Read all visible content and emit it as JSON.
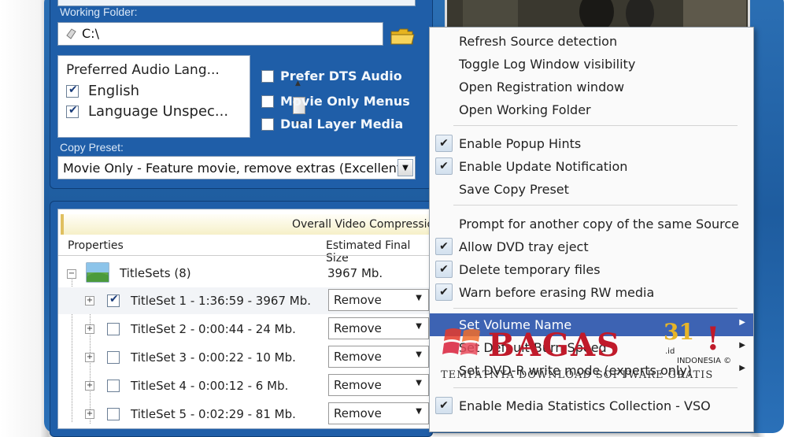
{
  "working_folder": {
    "label": "Working Folder:",
    "value": "C:\\"
  },
  "audio_languages": {
    "header": "Preferred Audio Lang...",
    "items": [
      {
        "label": "English",
        "checked": true
      },
      {
        "label": "Language Unspec...",
        "checked": true
      }
    ]
  },
  "options": {
    "prefer_dts": "Prefer DTS Audio",
    "movie_only_menus": "Movie Only Menus",
    "dual_layer": "Dual Layer Media"
  },
  "copy_preset": {
    "label": "Copy Preset:",
    "value": "Movie Only - Feature movie, remove extras (Excellent)"
  },
  "grid": {
    "banner": "Overall Video Compression",
    "col_properties": "Properties",
    "col_size": "Estimated Final Size",
    "root": {
      "label": "TitleSets (8)",
      "size": "3967 Mb."
    },
    "rows": [
      {
        "label": "TitleSet 1 -  1:36:59 - 3967 Mb.",
        "checked": true,
        "action": "Remove"
      },
      {
        "label": "TitleSet 2 -  0:00:44 - 24 Mb.",
        "checked": false,
        "action": "Remove"
      },
      {
        "label": "TitleSet 3 -  0:00:22 - 10 Mb.",
        "checked": false,
        "action": "Remove"
      },
      {
        "label": "TitleSet 4 -  0:00:12 - 6 Mb.",
        "checked": false,
        "action": "Remove"
      },
      {
        "label": "TitleSet 5 -  0:02:29 - 81 Mb.",
        "checked": false,
        "action": "Remove"
      }
    ]
  },
  "menu": {
    "items": [
      {
        "label": "Refresh Source detection",
        "checked": false
      },
      {
        "label": "Toggle Log Window visibility",
        "checked": false
      },
      {
        "label": "Open Registration window",
        "checked": false
      },
      {
        "label": "Open Working Folder",
        "checked": false
      },
      {
        "label": "Enable Popup Hints",
        "checked": true
      },
      {
        "label": "Enable Update Notification",
        "checked": true
      },
      {
        "label": "Save Copy Preset",
        "checked": false
      },
      {
        "label": "Prompt for another copy of the same Source",
        "checked": false
      },
      {
        "label": "Allow DVD tray eject",
        "checked": true
      },
      {
        "label": "Delete temporary files",
        "checked": true
      },
      {
        "label": "Warn before erasing RW media",
        "checked": true
      },
      {
        "label": "Set Volume Name",
        "checked": false,
        "submenu": true,
        "highlighted": true
      },
      {
        "label": "Set Default Burn Speed",
        "checked": false,
        "submenu": true
      },
      {
        "label": "Set DVD-R write mode (experts only)",
        "checked": false,
        "submenu": true
      },
      {
        "label": "Enable Media Statistics Collection - VSO",
        "checked": true
      }
    ]
  },
  "watermark": {
    "brand": "BAGAS",
    "number": "31",
    "suffix": ".id",
    "country": "INDONESIA",
    "copyright": "©",
    "tagline": "TEMPATNYA DOWNLOAD SOFTWARE GRATIS"
  },
  "colors": {
    "frame_blue": "#1f5ea8",
    "menu_highlight": "#3d63b3",
    "watermark_red": "#c01a2a",
    "watermark_gold": "#e6b428"
  }
}
